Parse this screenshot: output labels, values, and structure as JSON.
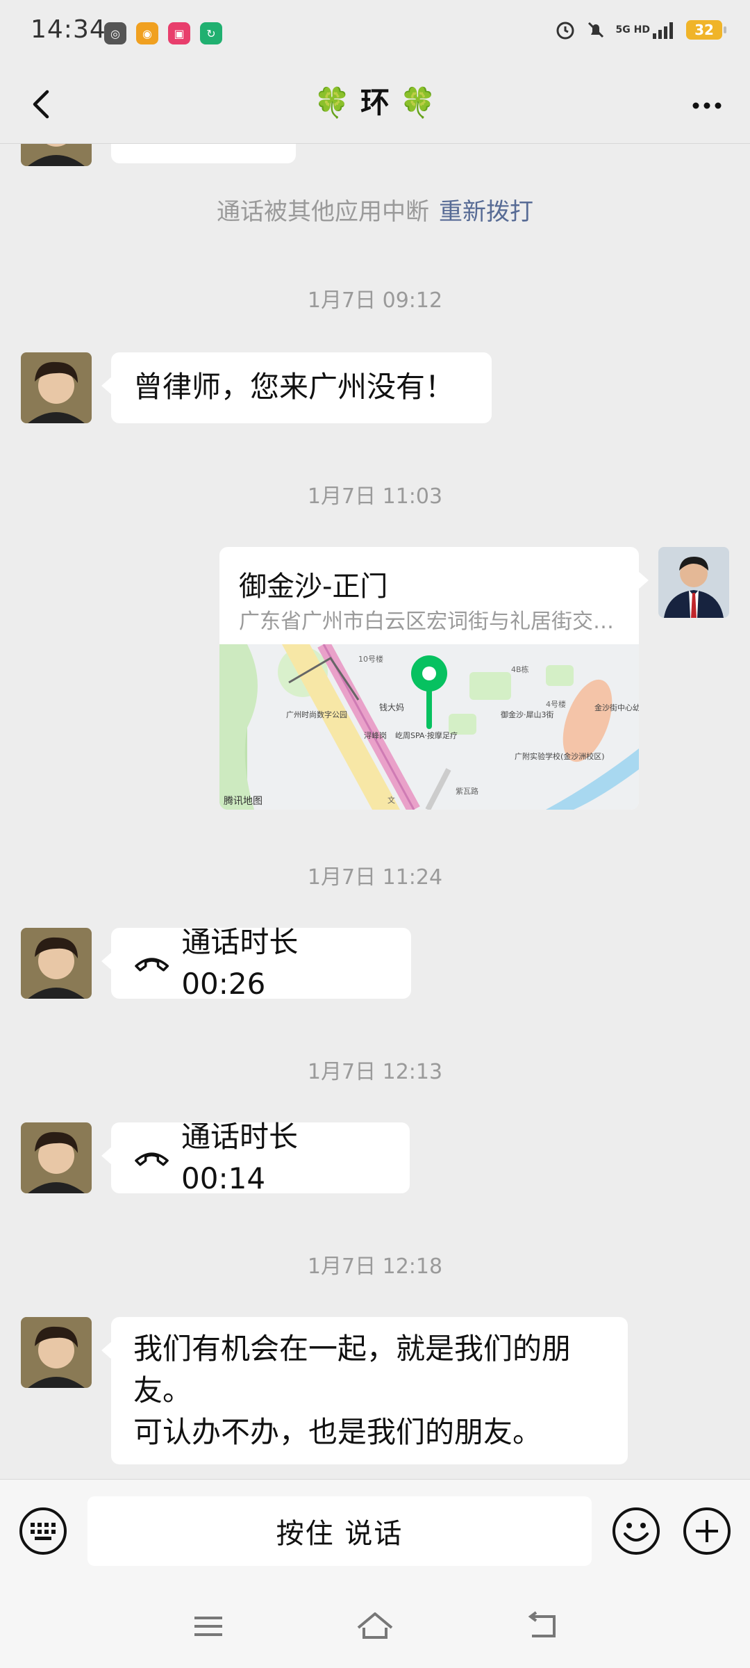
{
  "status_bar": {
    "time": "14:34",
    "network": "5G HD",
    "battery": "32",
    "colors": {
      "app1": "#555555",
      "app2": "#f0a020",
      "app3": "#e83e6c",
      "app4": "#20b070",
      "battery": "#f0b429"
    }
  },
  "header": {
    "title": "🍀 环 🍀"
  },
  "messages": {
    "system_notice": "通话被其他应用中断",
    "redial_label": "重新拨打",
    "ts1": "1月7日 09:12",
    "msg1": "曾律师，您来广州没有！",
    "ts2": "1月7日 11:03",
    "location": {
      "name": "御金沙-正门",
      "address": "广东省广州市白云区宏词街与礼居街交…",
      "map_provider": "腾讯地图",
      "map_labels": [
        "钱大妈",
        "广州时尚数字公园",
        "浔峰岗",
        "屹周SPA·按摩足疗",
        "御金沙·犀山3街",
        "广附实验学校(金沙洲校区)",
        "金沙街中心幼儿园",
        "10号楼",
        "4号楼",
        "4B栋",
        "紫瓦路",
        "文"
      ],
      "pin_color": "#07c160"
    },
    "ts3": "1月7日 11:24",
    "call1": "通话时长 00:26",
    "ts4": "1月7日 12:13",
    "call2": "通话时长 00:14",
    "ts5": "1月7日 12:18",
    "msg_last_line1": "我们有机会在一起，就是我们的朋",
    "msg_last_line2": "友。",
    "msg_last_line3": "可认办不办，也是我们的朋友。"
  },
  "input_bar": {
    "hold_to_talk": "按住 说话"
  },
  "icons": [
    "back-arrow-icon",
    "more-dots-icon",
    "keyboard-icon",
    "emoji-icon",
    "plus-icon",
    "phone-hangup-icon",
    "map-pin-icon",
    "menu-icon",
    "home-icon",
    "back-nav-icon"
  ]
}
